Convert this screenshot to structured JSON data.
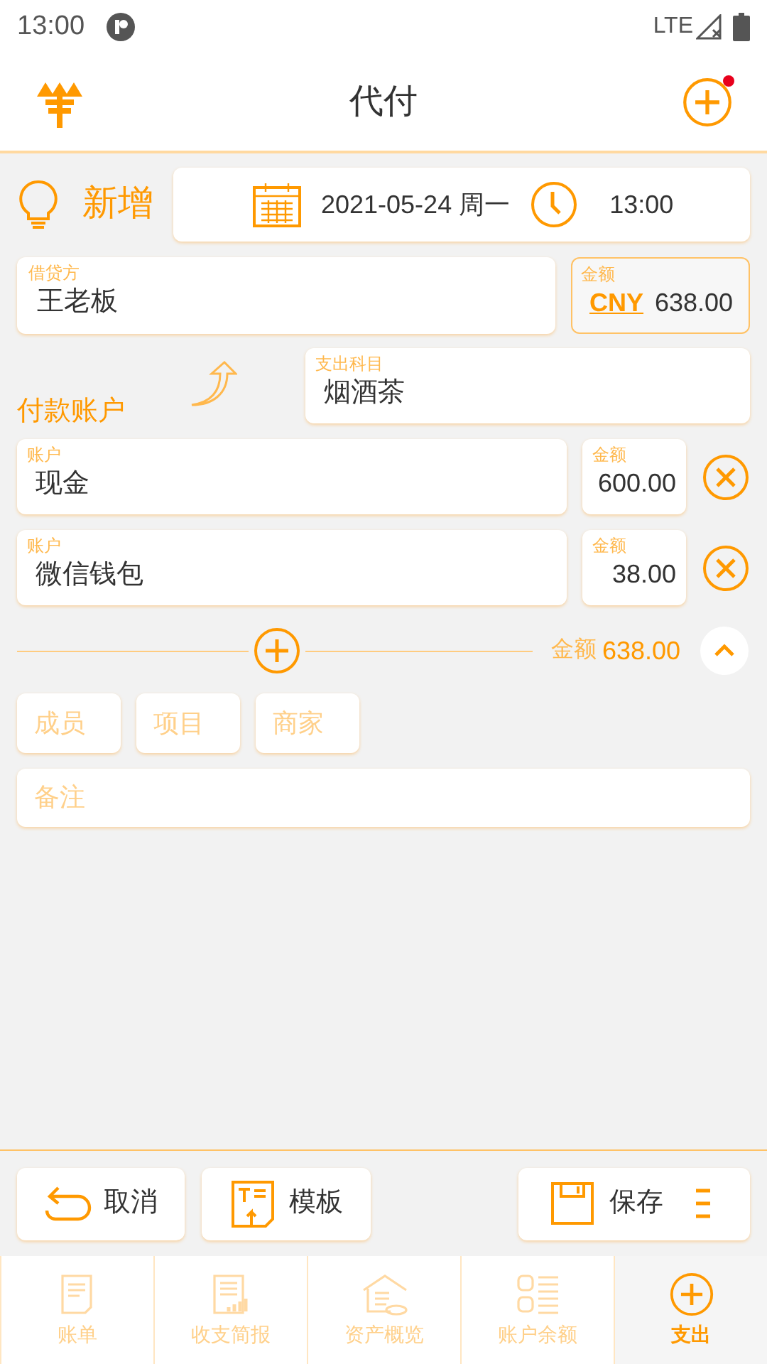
{
  "status_bar": {
    "time": "13:00",
    "network": "LTE"
  },
  "header": {
    "title": "代付"
  },
  "entry": {
    "mode": "新增",
    "date": "2021-05-24 周一",
    "time": "13:00"
  },
  "counterparty": {
    "label": "借贷方",
    "value": "王老板"
  },
  "amount": {
    "label": "金额",
    "currency": "CNY",
    "value": "638.00"
  },
  "category": {
    "label": "支出科目",
    "value": "烟酒茶"
  },
  "payment": {
    "title": "付款账户",
    "accounts": [
      {
        "label": "账户",
        "value": "现金",
        "amount_label": "金额",
        "amount": "600.00"
      },
      {
        "label": "账户",
        "value": "微信钱包",
        "amount_label": "金额",
        "amount": "38.00"
      }
    ],
    "total_label": "金额",
    "total": "638.00"
  },
  "tags": [
    {
      "placeholder": "成员"
    },
    {
      "placeholder": "项目"
    },
    {
      "placeholder": "商家"
    }
  ],
  "note": {
    "placeholder": "备注"
  },
  "actions": {
    "cancel": "取消",
    "template": "模板",
    "save": "保存"
  },
  "nav": [
    {
      "label": "账单",
      "selected": false
    },
    {
      "label": "收支简报",
      "selected": false
    },
    {
      "label": "资产概览",
      "selected": false
    },
    {
      "label": "账户余额",
      "selected": false
    },
    {
      "label": "支出",
      "selected": true
    }
  ]
}
